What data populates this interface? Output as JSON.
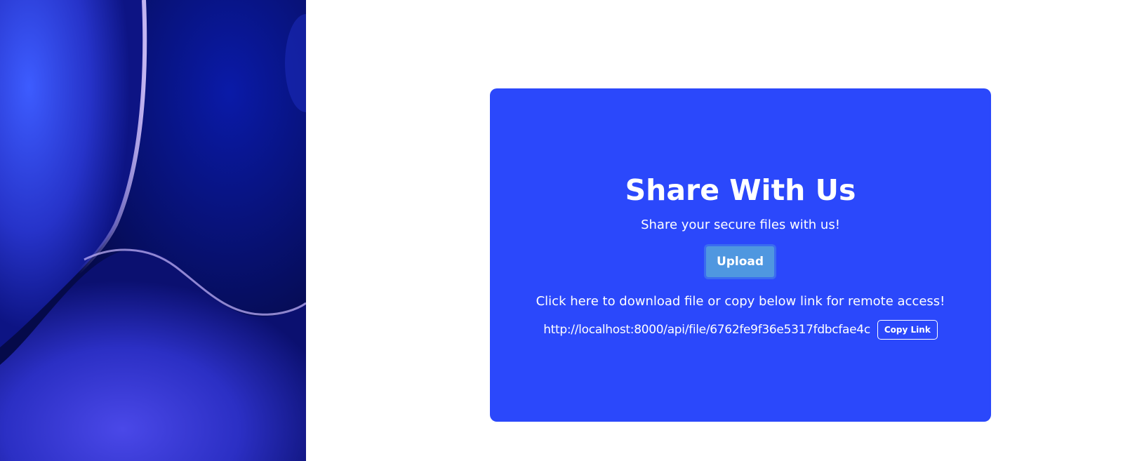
{
  "hero": {
    "description_icon": "abstract-wave-image"
  },
  "card": {
    "title": "Share With Us",
    "subtitle": "Share your secure files with us!",
    "upload_label": "Upload",
    "instruction": "Click here to download file or copy below link for remote access!",
    "file_link": "http://localhost:8000/api/file/6762fe9f36e5317fdbcfae4c",
    "copy_label": "Copy Link"
  },
  "colors": {
    "card_background": "#2b48fb",
    "upload_button": "#4f97e0",
    "page_background": "#ffffff"
  }
}
